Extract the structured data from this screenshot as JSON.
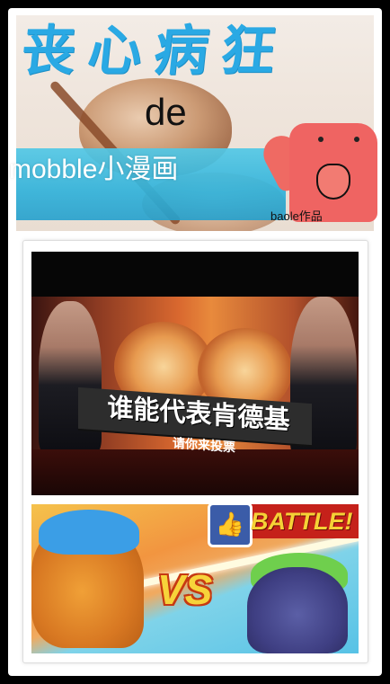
{
  "header": {
    "title_cn": "丧心病狂",
    "title_de": "de",
    "subtitle": "mobble小漫画",
    "credit": "baole作品"
  },
  "photo": {
    "ad_headline": "谁能代表肯德基",
    "ad_subline": "请你来投票"
  },
  "battle": {
    "battle_label": "BATTLE!",
    "vs_label": "VS",
    "like_icon": "thumbs-up-icon"
  },
  "colors": {
    "background": "#000000",
    "title_blue": "#2aa9e4",
    "band_cyan": "#31b2da",
    "mascot_red": "#ef6462",
    "battle_red": "#c5211a",
    "battle_yellow": "#f5d236"
  }
}
